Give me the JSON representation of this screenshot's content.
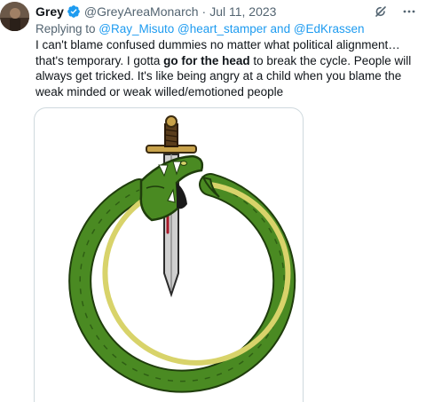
{
  "author": {
    "name": "Grey",
    "handle": "@GreyAreaMonarch",
    "separator": "·",
    "date": "Jul 11, 2023"
  },
  "reply": {
    "prefix": "Replying to ",
    "mention1": "@Ray_Misuto",
    "mention2": "@heart_stamper",
    "conjunction": " and ",
    "mention3": "@EdKrassen"
  },
  "body": {
    "part1": "I can't blame confused dummies no matter what political alignment… that's temporary.  I gotta ",
    "bold": "go for the head",
    "part2": " to break the cycle. People will always get tricked. It's like being angry at a child when you blame the weak minded or weak willed/emotioned people"
  },
  "icons": {
    "verified": "verified-badge-icon",
    "grok": "grok-icon",
    "more": "more-icon"
  },
  "colors": {
    "link": "#1d9bf0",
    "secondary": "#536471",
    "snake_green": "#3f7d1e",
    "snake_belly": "#d8d36a",
    "blade": "#c9c9c9"
  }
}
